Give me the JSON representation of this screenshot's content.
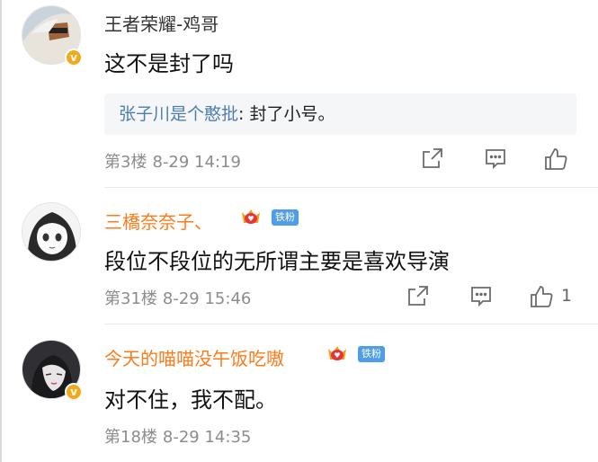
{
  "comments": [
    {
      "username": "王者荣耀-鸡哥",
      "text": "这不是封了吗",
      "reply": {
        "name": "张子川是个憨批",
        "separator": ": ",
        "text": "封了小号。"
      },
      "floor": "第3楼",
      "time": "8-29 14:19",
      "likes": ""
    },
    {
      "username": "三橋奈奈子、",
      "fan_badge": "铁粉",
      "text": "段位不段位的无所谓主要是喜欢导演",
      "floor": "第31楼",
      "time": "8-29 15:46",
      "likes": "1"
    },
    {
      "username": "今天的喵喵没午饭吃嗷",
      "fan_badge": "铁粉",
      "text": "对不住，我不配。",
      "floor": "第18楼",
      "time": "8-29 14:35"
    }
  ],
  "icons": {
    "share": "share-icon",
    "comment": "comment-icon",
    "like": "thumbs-up-icon",
    "verified": "verified-badge-icon",
    "crown": "vip-crown-icon"
  },
  "colors": {
    "vip_name": "#ff7b1a",
    "reply_name": "#4e7dab",
    "fan_badge": "#4f9de6",
    "verified": "#f3a91b"
  }
}
